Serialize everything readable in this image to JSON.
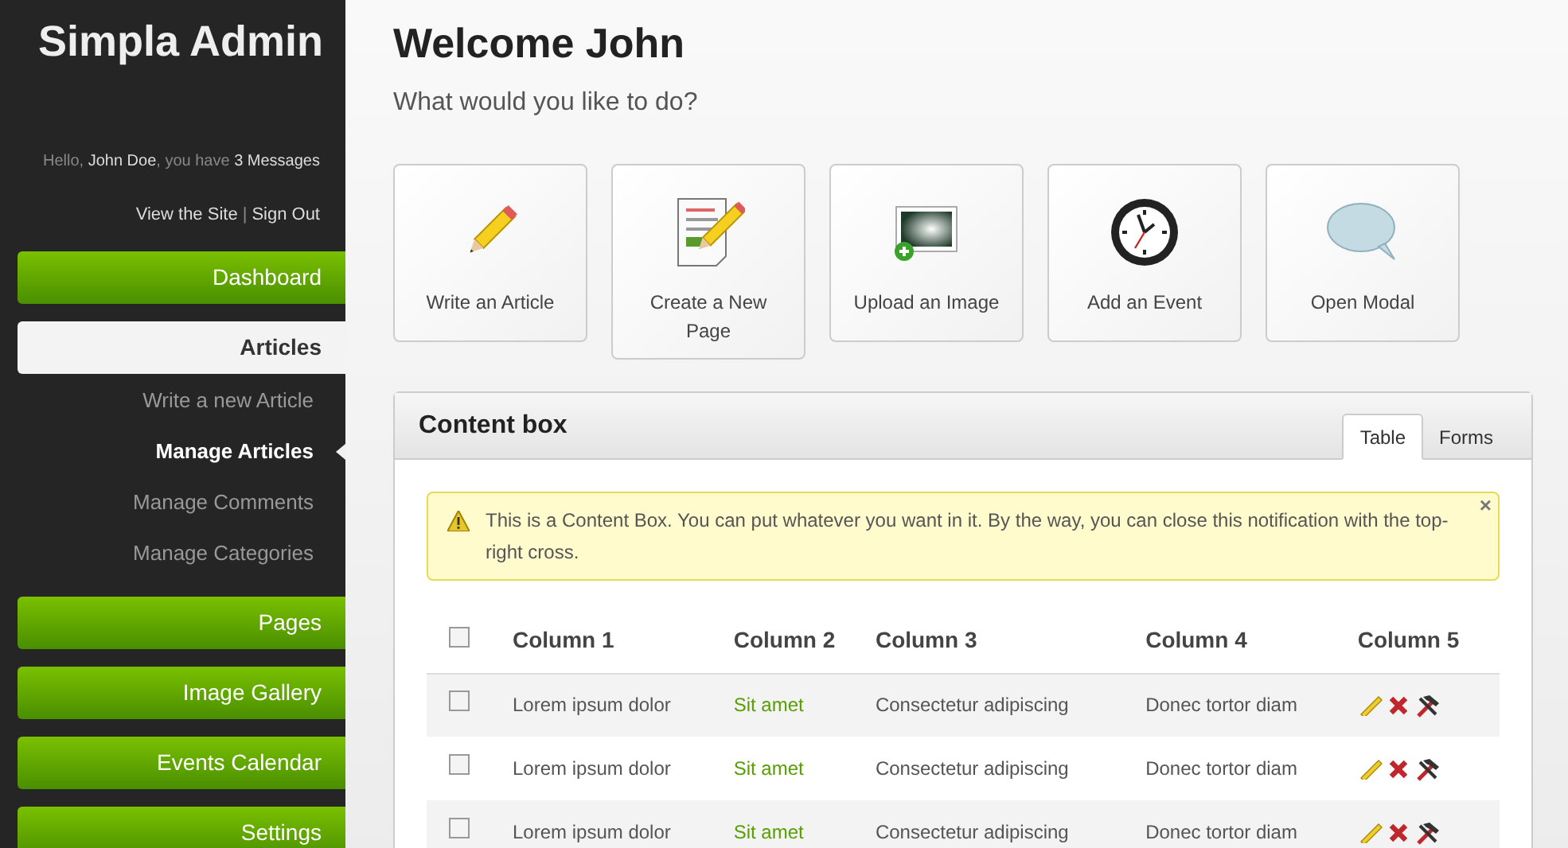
{
  "sidebar": {
    "logo": "Simpla Admin",
    "greeting": {
      "prefix": "Hello,",
      "user": "John Doe",
      "middle": ", you have",
      "messages": "3 Messages"
    },
    "links": {
      "view_site": "View the Site",
      "separator": "|",
      "sign_out": "Sign Out"
    },
    "nav": [
      {
        "label": "Dashboard",
        "selected": false
      },
      {
        "label": "Articles",
        "selected": true,
        "children": [
          {
            "label": "Write a new Article",
            "selected": false
          },
          {
            "label": "Manage Articles",
            "selected": true
          },
          {
            "label": "Manage Comments",
            "selected": false
          },
          {
            "label": "Manage Categories",
            "selected": false
          }
        ]
      },
      {
        "label": "Pages",
        "selected": false
      },
      {
        "label": "Image Gallery",
        "selected": false
      },
      {
        "label": "Events Calendar",
        "selected": false
      },
      {
        "label": "Settings",
        "selected": false
      }
    ]
  },
  "main": {
    "title": "Welcome John",
    "subtitle": "What would you like to do?",
    "shortcuts": [
      {
        "label": "Write an Article",
        "kind": "pencil"
      },
      {
        "label": "Create a New Page",
        "kind": "page"
      },
      {
        "label": "Upload an Image",
        "kind": "image"
      },
      {
        "label": "Add an Event",
        "kind": "clock"
      },
      {
        "label": "Open Modal",
        "kind": "bubble"
      }
    ],
    "content_box": {
      "title": "Content box",
      "tabs": [
        {
          "label": "Table",
          "selected": true
        },
        {
          "label": "Forms",
          "selected": false
        }
      ],
      "notification": {
        "text": "This is a Content Box. You can put whatever you want in it. By the way, you can close this notification with the top-right cross.",
        "close": "×"
      },
      "table": {
        "header_checked": false,
        "columns": [
          "Column 1",
          "Column 2",
          "Column 3",
          "Column 4",
          "Column 5"
        ],
        "rows": [
          {
            "checked": false,
            "cells": [
              "Lorem ipsum dolor",
              "Sit amet",
              "Consectetur adipiscing",
              "Donec tortor diam"
            ]
          },
          {
            "checked": false,
            "cells": [
              "Lorem ipsum dolor",
              "Sit amet",
              "Consectetur adipiscing",
              "Donec tortor diam"
            ]
          },
          {
            "checked": false,
            "cells": [
              "Lorem ipsum dolor",
              "Sit amet",
              "Consectetur adipiscing",
              "Donec tortor diam"
            ]
          }
        ]
      }
    }
  }
}
